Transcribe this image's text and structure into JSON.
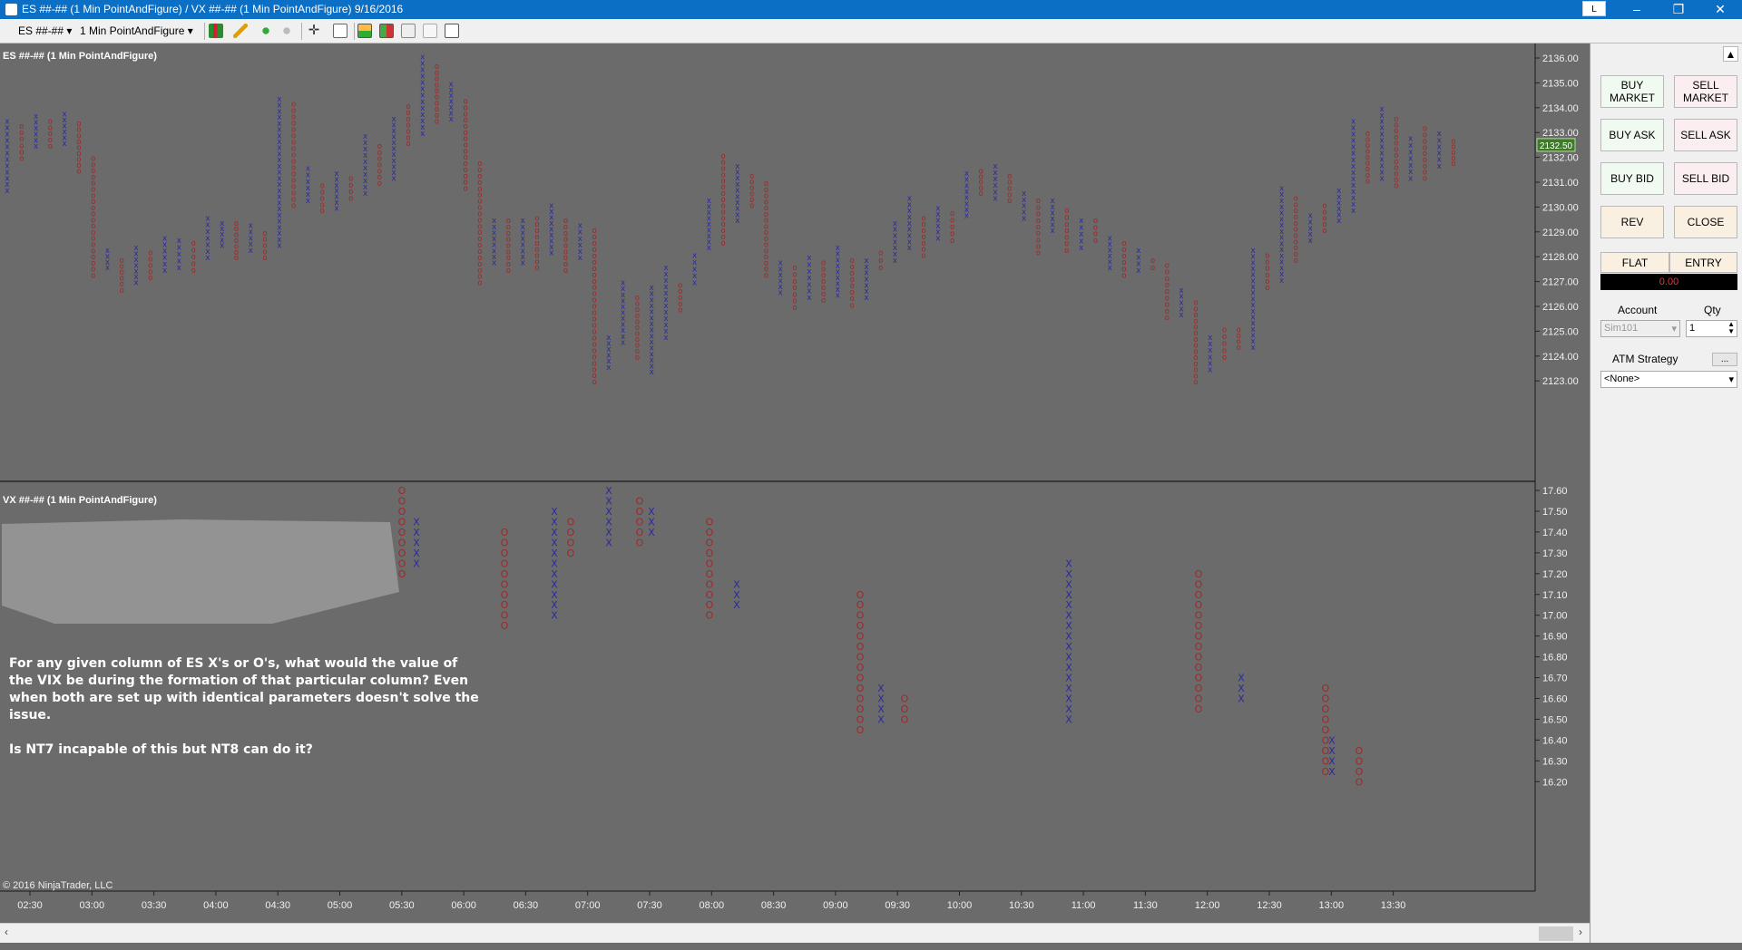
{
  "window": {
    "title": "ES ##-## (1 Min PointAndFigure) / VX ##-## (1 Min PointAndFigure)  9/16/2016",
    "l_button": "L",
    "min": "–",
    "restore": "❐",
    "close": "✕"
  },
  "toolbar": {
    "instrument": "ES ##-##",
    "interval": "1 Min PointAndFigure"
  },
  "chart": {
    "panel1_title": "ES ##-## (1 Min PointAndFigure)",
    "panel2_title": "VX ##-## (1 Min PointAndFigure)",
    "copyright": "© 2016 NinjaTrader, LLC",
    "last_price": "2132.50",
    "es_price_labels": [
      "2136.00",
      "2135.00",
      "2134.00",
      "2133.00",
      "2132.00",
      "2131.00",
      "2130.00",
      "2129.00",
      "2128.00",
      "2127.00",
      "2126.00",
      "2125.00",
      "2124.00",
      "2123.00"
    ],
    "vx_price_labels": [
      "17.60",
      "17.50",
      "17.40",
      "17.30",
      "17.20",
      "17.10",
      "17.00",
      "16.90",
      "16.80",
      "16.70",
      "16.60",
      "16.50",
      "16.40",
      "16.30",
      "16.20"
    ],
    "time_labels": [
      "02:30",
      "03:00",
      "03:30",
      "04:00",
      "04:30",
      "05:00",
      "05:30",
      "06:00",
      "06:30",
      "07:00",
      "07:30",
      "08:00",
      "08:30",
      "09:00",
      "09:30",
      "10:00",
      "10:30",
      "11:00",
      "11:30",
      "12:00",
      "12:30",
      "13:00",
      "13:30"
    ],
    "colors": {
      "x": "#2a2aa0",
      "o": "#a02828",
      "bg": "#6b6b6b",
      "axis": "#f0f0f0"
    }
  },
  "chart_data": [
    {
      "type": "point-and-figure",
      "title": "ES ##-## (1 Min PointAndFigure)",
      "ylim": [
        2122.5,
        2136.5
      ],
      "ylabel_ticks": [
        2123,
        2124,
        2125,
        2126,
        2127,
        2128,
        2129,
        2130,
        2131,
        2132,
        2133,
        2134,
        2135,
        2136
      ],
      "last_price": 2132.5,
      "columns": [
        [
          "X",
          2130.7,
          2133.5
        ],
        [
          "O",
          2132.0,
          2133.3
        ],
        [
          "X",
          2132.5,
          2133.7
        ],
        [
          "O",
          2132.5,
          2133.5
        ],
        [
          "X",
          2132.6,
          2133.8
        ],
        [
          "O",
          2131.5,
          2133.4
        ],
        [
          "O",
          2127.3,
          2132.0
        ],
        [
          "X",
          2127.6,
          2128.3
        ],
        [
          "O",
          2126.7,
          2127.9
        ],
        [
          "X",
          2127.0,
          2128.4
        ],
        [
          "O",
          2127.2,
          2128.2
        ],
        [
          "X",
          2127.5,
          2128.8
        ],
        [
          "X",
          2127.6,
          2128.7
        ],
        [
          "O",
          2127.5,
          2128.6
        ],
        [
          "X",
          2128.0,
          2129.6
        ],
        [
          "X",
          2128.5,
          2129.4
        ],
        [
          "O",
          2128.0,
          2129.4
        ],
        [
          "X",
          2128.3,
          2129.3
        ],
        [
          "O",
          2128.0,
          2129.0
        ],
        [
          "X",
          2128.5,
          2134.4
        ],
        [
          "O",
          2130.1,
          2134.2
        ],
        [
          "X",
          2130.3,
          2131.6
        ],
        [
          "O",
          2129.9,
          2130.9
        ],
        [
          "X",
          2130.0,
          2131.4
        ],
        [
          "O",
          2130.4,
          2131.2
        ],
        [
          "X",
          2130.6,
          2132.9
        ],
        [
          "O",
          2131.0,
          2132.5
        ],
        [
          "X",
          2131.2,
          2133.6
        ],
        [
          "O",
          2132.6,
          2134.1
        ],
        [
          "X",
          2133.0,
          2136.1
        ],
        [
          "O",
          2133.5,
          2135.7
        ],
        [
          "X",
          2133.6,
          2135.0
        ],
        [
          "O",
          2130.8,
          2134.3
        ],
        [
          "O",
          2127.0,
          2131.8
        ],
        [
          "X",
          2127.8,
          2129.5
        ],
        [
          "O",
          2127.5,
          2129.5
        ],
        [
          "X",
          2127.8,
          2129.5
        ],
        [
          "O",
          2127.6,
          2129.6
        ],
        [
          "X",
          2128.2,
          2130.1
        ],
        [
          "O",
          2127.5,
          2129.5
        ],
        [
          "X",
          2128.0,
          2129.3
        ],
        [
          "O",
          2123.0,
          2129.1
        ],
        [
          "X",
          2123.6,
          2124.8
        ],
        [
          "X",
          2124.6,
          2127.0
        ],
        [
          "O",
          2124.0,
          2126.4
        ],
        [
          "X",
          2123.4,
          2126.8
        ],
        [
          "X",
          2124.8,
          2127.6
        ],
        [
          "O",
          2125.9,
          2126.9
        ],
        [
          "X",
          2127.0,
          2128.1
        ],
        [
          "X",
          2128.4,
          2130.3
        ],
        [
          "O",
          2128.6,
          2132.1
        ],
        [
          "X",
          2129.5,
          2131.7
        ],
        [
          "O",
          2130.1,
          2131.3
        ],
        [
          "O",
          2127.3,
          2131.0
        ],
        [
          "X",
          2126.6,
          2127.8
        ],
        [
          "O",
          2126.0,
          2127.6
        ],
        [
          "X",
          2126.4,
          2128.0
        ],
        [
          "O",
          2126.3,
          2127.8
        ],
        [
          "X",
          2126.5,
          2128.4
        ],
        [
          "O",
          2126.1,
          2127.9
        ],
        [
          "X",
          2126.4,
          2127.9
        ],
        [
          "O",
          2127.6,
          2128.2
        ],
        [
          "X",
          2127.9,
          2129.4
        ],
        [
          "X",
          2128.4,
          2130.4
        ],
        [
          "O",
          2128.1,
          2129.6
        ],
        [
          "X",
          2128.8,
          2130.0
        ],
        [
          "O",
          2128.7,
          2129.8
        ],
        [
          "X",
          2129.7,
          2131.4
        ],
        [
          "O",
          2130.6,
          2131.5
        ],
        [
          "X",
          2130.4,
          2131.7
        ],
        [
          "O",
          2130.3,
          2131.3
        ],
        [
          "X",
          2129.6,
          2130.6
        ],
        [
          "O",
          2128.2,
          2130.3
        ],
        [
          "X",
          2129.1,
          2130.3
        ],
        [
          "O",
          2128.3,
          2129.9
        ],
        [
          "X",
          2128.4,
          2129.5
        ],
        [
          "O",
          2128.7,
          2129.5
        ],
        [
          "X",
          2127.6,
          2128.8
        ],
        [
          "O",
          2127.3,
          2128.6
        ],
        [
          "X",
          2127.5,
          2128.3
        ],
        [
          "O",
          2127.6,
          2127.9
        ],
        [
          "O",
          2125.6,
          2127.7
        ],
        [
          "X",
          2125.7,
          2126.7
        ],
        [
          "O",
          2123.0,
          2126.2
        ],
        [
          "X",
          2123.5,
          2124.8
        ],
        [
          "O",
          2124.0,
          2125.1
        ],
        [
          "O",
          2124.4,
          2125.1
        ],
        [
          "X",
          2124.4,
          2128.3
        ],
        [
          "O",
          2126.8,
          2128.1
        ],
        [
          "X",
          2127.1,
          2130.8
        ],
        [
          "O",
          2127.9,
          2130.4
        ],
        [
          "X",
          2128.7,
          2129.7
        ],
        [
          "O",
          2129.1,
          2130.1
        ],
        [
          "X",
          2129.5,
          2130.7
        ],
        [
          "X",
          2129.9,
          2133.5
        ],
        [
          "O",
          2131.1,
          2133.0
        ],
        [
          "X",
          2131.2,
          2134.0
        ],
        [
          "O",
          2130.9,
          2133.6
        ],
        [
          "X",
          2131.2,
          2132.8
        ],
        [
          "O",
          2131.2,
          2133.2
        ],
        [
          "X",
          2131.7,
          2133.0
        ],
        [
          "O",
          2131.8,
          2132.7
        ]
      ]
    },
    {
      "type": "point-and-figure",
      "title": "VX ##-## (1 Min PointAndFigure)",
      "ylim": [
        16.15,
        17.65
      ],
      "ylabel_ticks": [
        16.2,
        16.3,
        16.4,
        16.5,
        16.6,
        16.7,
        16.8,
        16.9,
        17.0,
        17.1,
        17.2,
        17.3,
        17.4,
        17.5,
        17.6
      ],
      "columns": [
        [
          "O",
          17.2,
          17.6
        ],
        [
          "X",
          17.25,
          17.45
        ],
        [
          "O",
          16.95,
          17.4
        ],
        [
          "X",
          17.0,
          17.5
        ],
        [
          "O",
          17.3,
          17.45
        ],
        [
          "X",
          17.35,
          17.6
        ],
        [
          "O",
          17.35,
          17.55
        ],
        [
          "X",
          17.4,
          17.5
        ],
        [
          "O",
          17.0,
          17.45
        ],
        [
          "X",
          17.05,
          17.15
        ],
        [
          "O",
          16.45,
          17.1
        ],
        [
          "X",
          16.5,
          16.65
        ],
        [
          "O",
          16.5,
          16.6
        ],
        [
          "X",
          16.5,
          17.25
        ],
        [
          "O",
          16.55,
          17.2
        ],
        [
          "X",
          16.6,
          16.7
        ],
        [
          "O",
          16.25,
          16.65
        ],
        [
          "X",
          16.25,
          16.4
        ],
        [
          "O",
          16.2,
          16.35
        ]
      ]
    }
  ],
  "annotation": {
    "p1": "For any given column of ES X's or O's, what would the value of the VIX be during the formation of that particular column? Even when both are set up with identical parameters doesn't solve the issue.",
    "p2": "Is NT7 incapable of this but NT8 can do it?"
  },
  "side": {
    "buy_market": "BUY MARKET",
    "sell_market": "SELL MARKET",
    "buy_ask": "BUY ASK",
    "sell_ask": "SELL ASK",
    "buy_bid": "BUY BID",
    "sell_bid": "SELL BID",
    "rev": "REV",
    "close": "CLOSE",
    "flat": "FLAT",
    "entry": "ENTRY",
    "pnl": "0.00",
    "account_label": "Account",
    "qty_label": "Qty",
    "account": "Sim101",
    "qty": "1",
    "atm_label": "ATM Strategy",
    "atm_value": "<None>",
    "atm_btn": "..."
  }
}
